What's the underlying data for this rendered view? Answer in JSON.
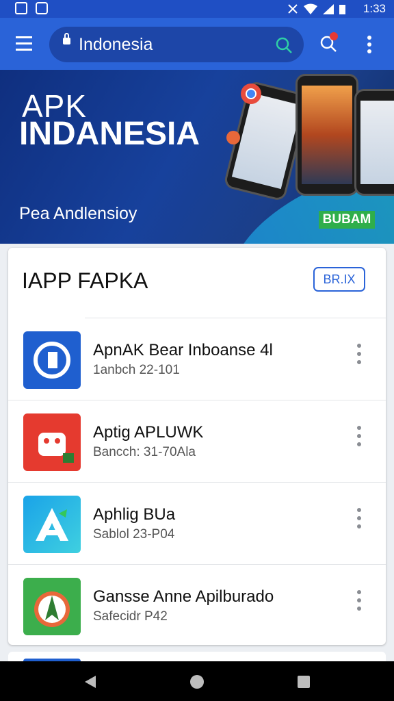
{
  "status_bar": {
    "time": "1:33"
  },
  "search": {
    "query": "Indonesia"
  },
  "banner": {
    "title_line1": "APK",
    "title_line2": "INDANESIA",
    "tagline": "Pea Andlensioy",
    "badge": "BUBAM"
  },
  "list_card": {
    "title": "IAPP FAPKA",
    "action_label": "BR.IX",
    "items": [
      {
        "name": "ApnAK Bear Inboanse 4l",
        "subtitle": "1anbch 22-101",
        "icon": "blue-app-icon"
      },
      {
        "name": "Aptig APLUWK",
        "subtitle": "Bancch: 31-70Ala",
        "icon": "android-robot-icon"
      },
      {
        "name": "Aphlig BUa",
        "subtitle": "Sablol 23-P04",
        "icon": "letter-a-icon"
      },
      {
        "name": "Gansse Anne Apilburado",
        "subtitle": "Safecidr P42",
        "icon": "compass-icon"
      }
    ]
  },
  "colors": {
    "primary": "#2a63d8",
    "banner_bg": "#17419c",
    "badge_green": "#2fae4b"
  }
}
